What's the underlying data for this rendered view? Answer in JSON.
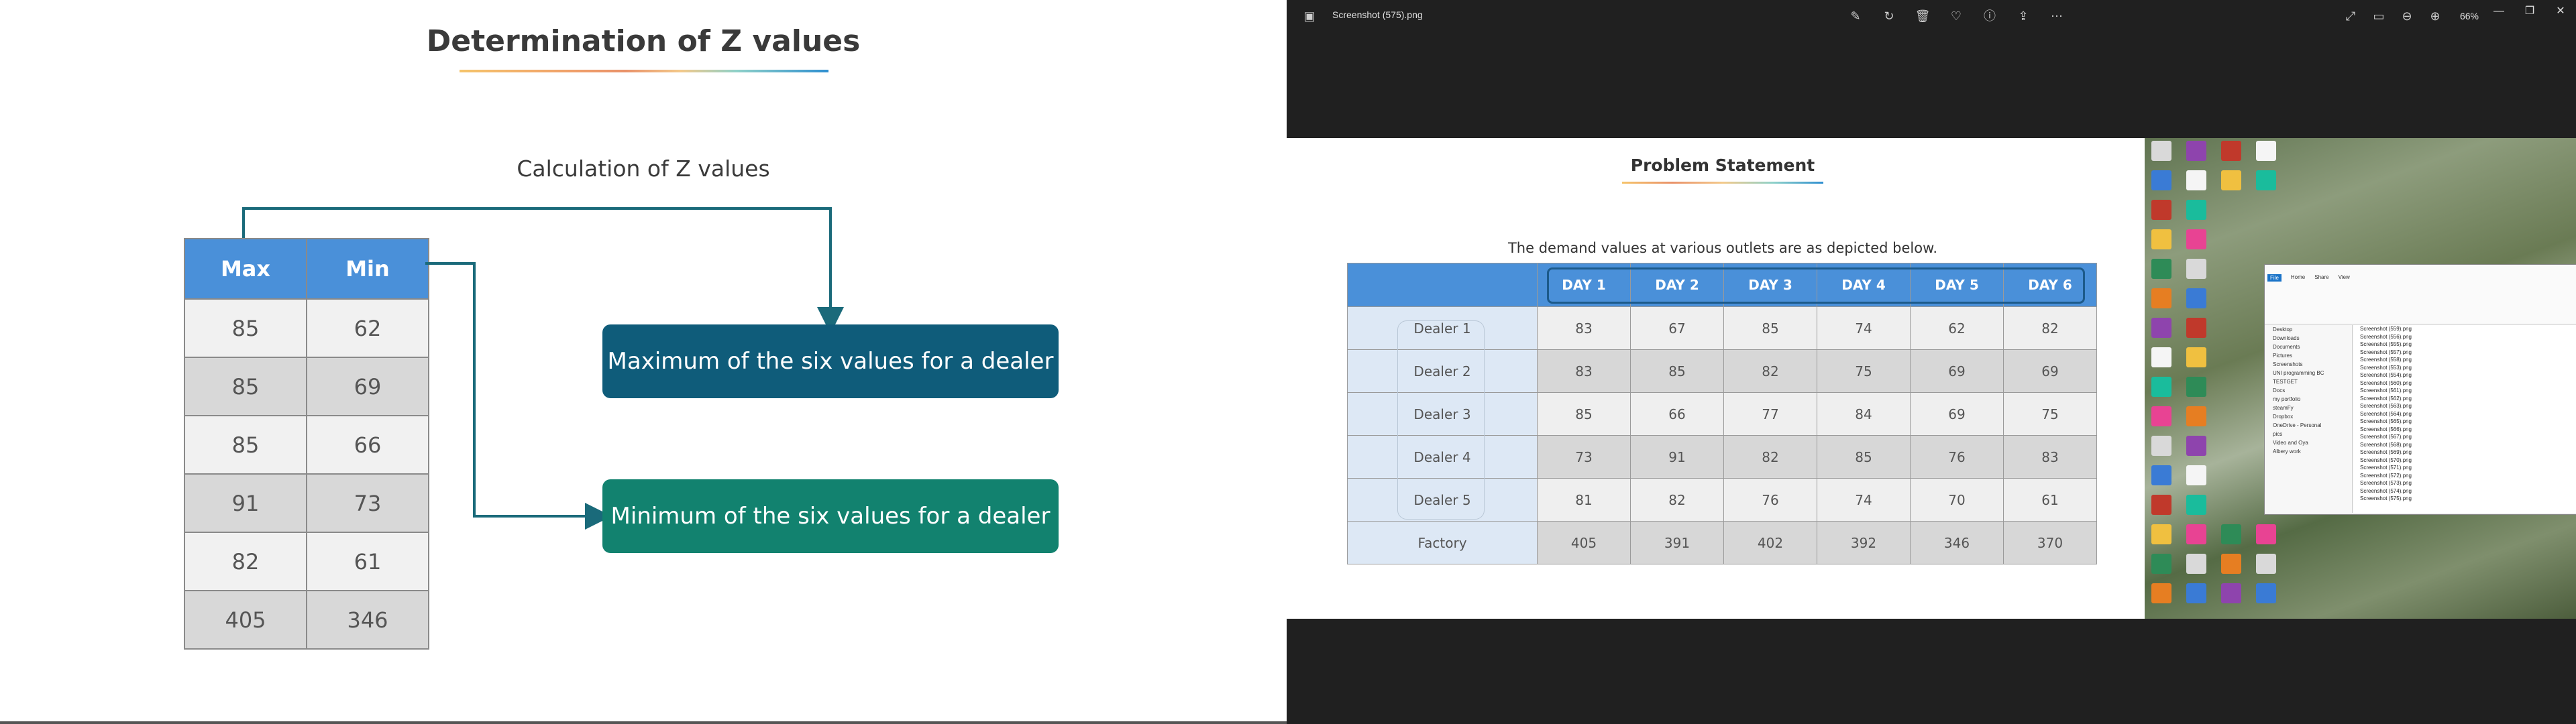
{
  "left_slide": {
    "title": "Determination of Z values",
    "calc_label": "Calculation of Z values",
    "table": {
      "headers": [
        "Max",
        "Min"
      ],
      "rows": [
        [
          "85",
          "62"
        ],
        [
          "85",
          "69"
        ],
        [
          "85",
          "66"
        ],
        [
          "91",
          "73"
        ],
        [
          "82",
          "61"
        ],
        [
          "405",
          "346"
        ]
      ]
    },
    "callout_max": "Maximum of the six values for a dealer",
    "callout_min": "Minimum of the six values for a dealer",
    "colors": {
      "header_blue": "#4a90d9",
      "callout_max": "#0f5c7a",
      "callout_min": "#12826f"
    }
  },
  "viewer": {
    "file_title": "Screenshot (575).png",
    "zoom": "66%",
    "tool_icons": [
      "edit-icon",
      "rotate-icon",
      "delete-icon",
      "favorite-icon",
      "info-icon",
      "share-icon",
      "more-icon"
    ],
    "right_icons": [
      "fullscreen-icon",
      "fit-icon",
      "zoom-out-icon",
      "zoom-in-icon"
    ],
    "window_controls": [
      "minimize-icon",
      "maximize-icon",
      "close-icon"
    ],
    "image": {
      "title": "Problem Statement",
      "description": "The demand values at various outlets are as depicted below.",
      "headers": [
        "DAY 1",
        "DAY 2",
        "DAY 3",
        "DAY 4",
        "DAY 5",
        "DAY 6"
      ],
      "rows": [
        {
          "label": "Dealer 1",
          "values": [
            "83",
            "67",
            "85",
            "74",
            "62",
            "82"
          ]
        },
        {
          "label": "Dealer 2",
          "values": [
            "83",
            "85",
            "82",
            "75",
            "69",
            "69"
          ]
        },
        {
          "label": "Dealer 3",
          "values": [
            "85",
            "66",
            "77",
            "84",
            "69",
            "75"
          ]
        },
        {
          "label": "Dealer 4",
          "values": [
            "73",
            "91",
            "82",
            "85",
            "76",
            "83"
          ]
        },
        {
          "label": "Dealer 5",
          "values": [
            "81",
            "82",
            "76",
            "74",
            "70",
            "61"
          ]
        },
        {
          "label": "Factory",
          "values": [
            "405",
            "391",
            "402",
            "392",
            "346",
            "370"
          ]
        }
      ]
    },
    "explorer": {
      "tabs": [
        "File",
        "Home",
        "Share",
        "View"
      ],
      "nav_items": [
        "Desktop",
        "Downloads",
        "Documents",
        "Pictures",
        "Screenshots",
        "UNI programming BC",
        "TESTGET",
        "Docs",
        "my portfolio",
        "steamFy",
        "Dropbox",
        "OneDrive - Personal",
        "pics",
        "Video and Oya",
        "Albery work"
      ],
      "files": [
        "Screenshot (559).png",
        "Screenshot (556).png",
        "Screenshot (555).png",
        "Screenshot (557).png",
        "Screenshot (558).png",
        "Screenshot (553).png",
        "Screenshot (554).png",
        "Screenshot (560).png",
        "Screenshot (561).png",
        "Screenshot (562).png",
        "Screenshot (563).png",
        "Screenshot (564).png",
        "Screenshot (565).png",
        "Screenshot (566).png",
        "Screenshot (567).png",
        "Screenshot (568).png",
        "Screenshot (569).png",
        "Screenshot (570).png",
        "Screenshot (571).png",
        "Screenshot (572).png",
        "Screenshot (573).png",
        "Screenshot (574).png",
        "Screenshot (575).png"
      ]
    }
  }
}
